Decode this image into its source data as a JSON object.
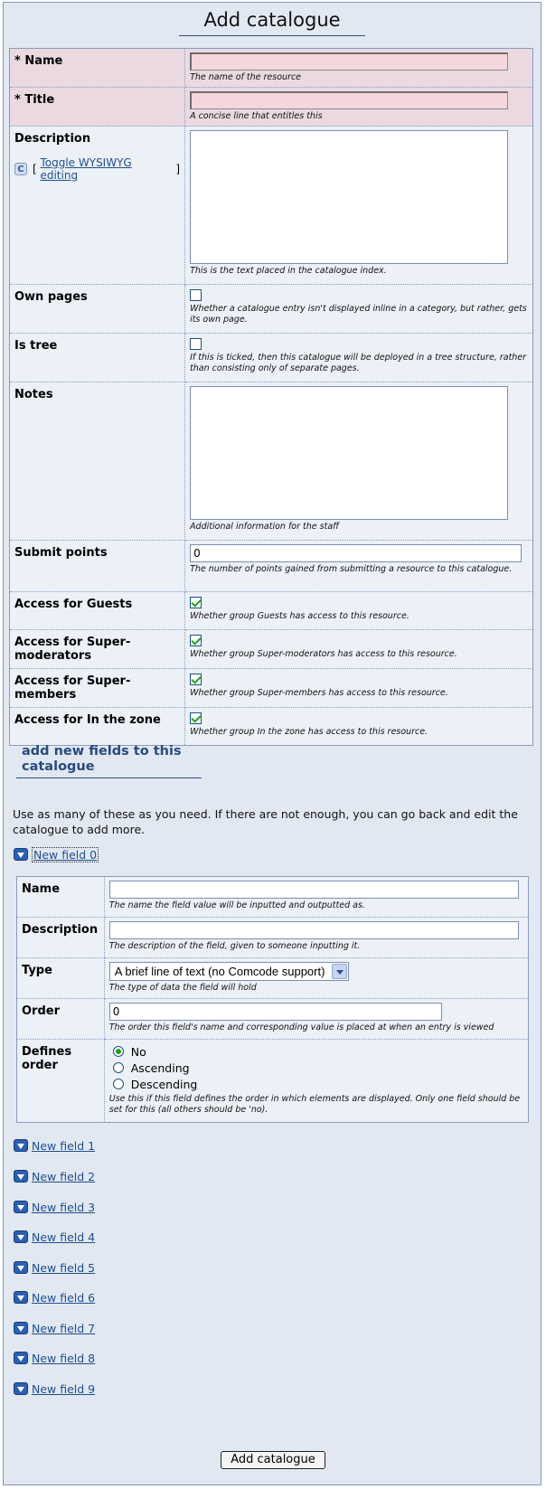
{
  "page": {
    "title": "Add catalogue"
  },
  "form": {
    "name": {
      "label": "* Name",
      "value": "",
      "desc": "The name of the resource"
    },
    "title": {
      "label": "* Title",
      "value": "",
      "desc": "A concise line that entitles this"
    },
    "description": {
      "label": "Description",
      "toggle_prefix": "[",
      "toggle_label": "Toggle WYSIWYG editing",
      "toggle_suffix": "]",
      "desc": "This is the text placed in the catalogue index."
    },
    "own_pages": {
      "label": "Own pages",
      "checked": false,
      "desc": "Whether a catalogue entry isn't displayed inline in a category, but rather, gets its own page."
    },
    "is_tree": {
      "label": "Is tree",
      "checked": false,
      "desc": "If this is ticked, then this catalogue will be deployed in a tree structure, rather than consisting only of separate pages."
    },
    "notes": {
      "label": "Notes",
      "desc": "Additional information for the staff"
    },
    "submit_points": {
      "label": "Submit points",
      "value": "0",
      "desc": "The number of points gained from submitting a resource to this catalogue."
    },
    "access_guests": {
      "label": "Access for Guests",
      "checked": true,
      "desc": "Whether group Guests has access to this resource."
    },
    "access_supermods": {
      "label": "Access for Super-moderators",
      "checked": true,
      "desc": "Whether group Super-moderators has access to this resource."
    },
    "access_supermembers": {
      "label": "Access for Super-members",
      "checked": true,
      "desc": "Whether group Super-members has access to this resource."
    },
    "access_inzone": {
      "label": "Access for In the zone",
      "checked": true,
      "desc": "Whether group In the zone has access to this resource."
    }
  },
  "fields_section": {
    "title": "add new fields to this catalogue",
    "intro": "Use as many of these as you need. If there are not enough, you can go back and edit the catalogue to add more.",
    "expanded": {
      "toggle_label": "New field 0",
      "name": {
        "label": "Name",
        "value": "",
        "desc": "The name the field value will be inputted and outputted as."
      },
      "description": {
        "label": "Description",
        "value": "",
        "desc": "The description of the field, given to someone inputting it."
      },
      "type": {
        "label": "Type",
        "selected": "A brief line of text (no Comcode support)",
        "desc": "The type of data the field will hold"
      },
      "order": {
        "label": "Order",
        "value": "0",
        "desc": "The order this field's name and corresponding value is placed at when an entry is viewed"
      },
      "defines_order": {
        "label": "Defines order",
        "options": [
          "No",
          "Ascending",
          "Descending"
        ],
        "selected": "No",
        "desc": "Use this if this field defines the order in which elements are displayed. Only one field should be set for this (all others should be 'no)."
      }
    },
    "collapsed": [
      "New field 1",
      "New field 2",
      "New field 3",
      "New field 4",
      "New field 5",
      "New field 6",
      "New field 7",
      "New field 8",
      "New field 9"
    ]
  },
  "submit": {
    "label": "Add catalogue"
  }
}
